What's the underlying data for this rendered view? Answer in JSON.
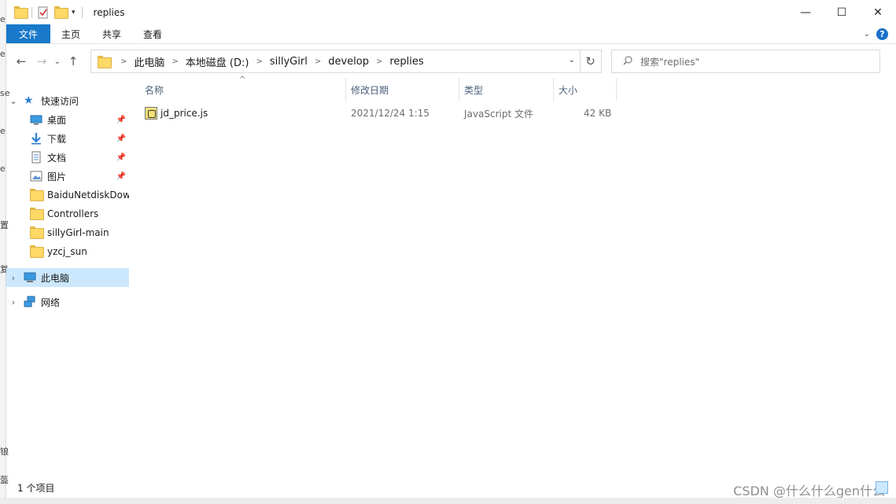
{
  "window": {
    "title": "replies",
    "controls": {
      "minimize": "—",
      "maximize": "☐",
      "close": "✕"
    }
  },
  "ribbon": {
    "tabs": [
      "文件",
      "主页",
      "共享",
      "查看"
    ],
    "expand_icon": "chevron-down-icon",
    "help_label": "?"
  },
  "nav": {
    "back": "←",
    "forward": "→",
    "recent": "⌄",
    "up": "↑",
    "breadcrumb": [
      "此电脑",
      "本地磁盘 (D:)",
      "sillyGirl",
      "develop",
      "replies"
    ],
    "refresh": "↻",
    "search_placeholder": "搜索\"replies\""
  },
  "sidebar": {
    "quick_access": "快速访问",
    "pinned": [
      "桌面",
      "下载",
      "文档",
      "图片"
    ],
    "folders": [
      "BaiduNetdiskDow",
      "Controllers",
      "sillyGirl-main",
      "yzcj_sun"
    ],
    "this_pc": "此电脑",
    "network": "网络"
  },
  "columns": [
    "名称",
    "修改日期",
    "类型",
    "大小"
  ],
  "files": [
    {
      "name": "jd_price.js",
      "modified": "2021/12/24 1:15",
      "type": "JavaScript 文件",
      "size": "42 KB"
    }
  ],
  "status": {
    "item_count": "1 个项目"
  },
  "watermark": "CSDN @什么什么gen什么",
  "colors": {
    "file_tab": "#1979ca",
    "selected": "#cce8ff",
    "header_text": "#4c607a"
  }
}
